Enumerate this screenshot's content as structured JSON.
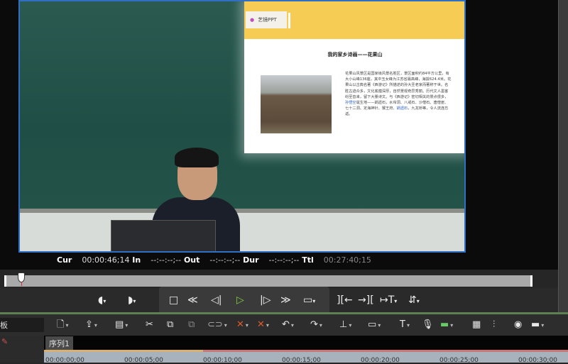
{
  "slide": {
    "logo": "艺镜PPT",
    "title": "我的家乡诗画——花果山",
    "body": "花果山风景区是国家级风景名胜区，景区面积约84平方公里，有大小山峰136座，其中玉女峰为江苏省最高峰，海拔624.4米。花果山以古典名著《西游记》所描述的孙大圣老家而著称于世。名胜古迹众多，文化底蕴深厚，自然景观奇异秀丽。历代文人墨客纷至沓来，留下大量诗文。与《西游记》密切相关的景点很多，",
    "link1": "孙悟空",
    "body2": "诞生地——娲遗石，水帘洞、八戒石、沙僧石、唐僧崖、七十二洞、定海神针、猴王府、",
    "link2": "娲遗石",
    "body3": "，九龙桥等，令人流连忘返。"
  },
  "timecodes": {
    "cur_label": "Cur",
    "cur": "00:00:46;14",
    "in_label": "In",
    "in": "--:--:--;--",
    "out_label": "Out",
    "out": "--:--:--;--",
    "dur_label": "Dur",
    "dur": "--:--:--;--",
    "ttl_label": "Ttl",
    "ttl": "00:27:40;15"
  },
  "panel_label": "板",
  "sequence_tab": "序列1",
  "ruler": [
    "00:00:00;00",
    "00:00:05;00",
    "00:00:10;00",
    "00:00:15;00",
    "00:00:20;00",
    "00:00:25;00",
    "00:00:30;00"
  ],
  "playback_position": 0.028
}
